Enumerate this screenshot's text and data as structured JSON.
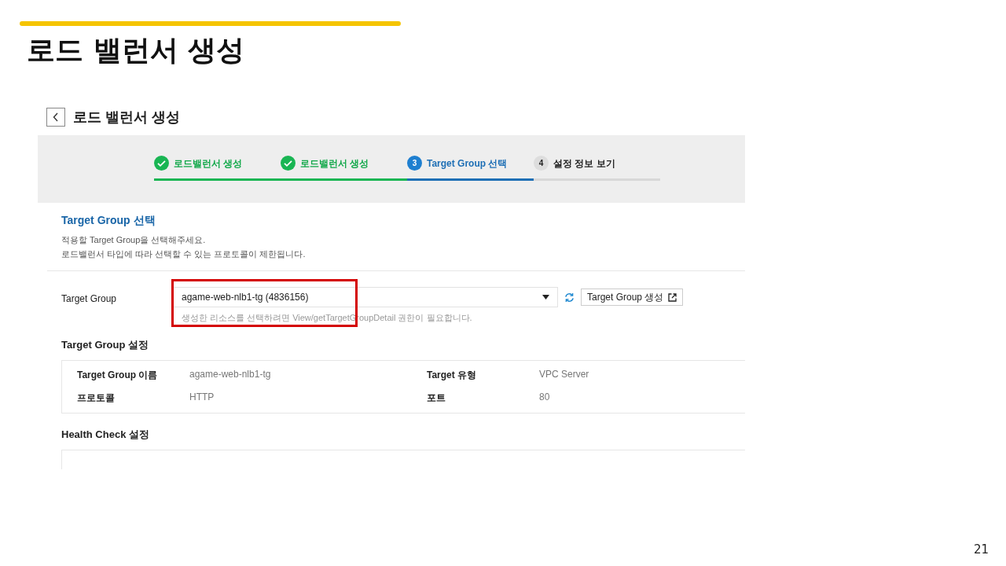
{
  "slide": {
    "title": "로드 밸런서 생성",
    "page_number": "21"
  },
  "screen": {
    "title": "로드 밸런서 생성",
    "steps": [
      {
        "label": "로드밸런서 생성",
        "done": true,
        "current": false
      },
      {
        "label": "로드밸런서 생성",
        "done": true,
        "current": false
      },
      {
        "label": "Target Group 선택",
        "number": "3",
        "done": false,
        "current": true
      },
      {
        "label": "설정 정보 보기",
        "number": "4",
        "done": false,
        "current": false
      }
    ],
    "section": {
      "title": "Target Group 선택",
      "description": [
        "적용할 Target Group을 선택해주세요.",
        "로드밸런서 타입에 따라 선택할 수 있는 프로토콜이 제한됩니다."
      ]
    },
    "target_group": {
      "label": "Target Group",
      "value": "agame-web-nlb1-tg (4836156)",
      "create_button": "Target Group 생성",
      "help": "생성한 리소스를 선택하려면 View/getTargetGroupDetail 권한이 필요합니다.",
      "highlighted": true
    },
    "settings": [
      {
        "title": "Target Group 설정",
        "rows": [
          {
            "label1": "Target Group 이름",
            "value1": "agame-web-nlb1-tg",
            "label2": "Target 유형",
            "value2": "VPC Server"
          },
          {
            "label1": "프로토콜",
            "value1": "HTTP",
            "label2": "포트",
            "value2": "80"
          }
        ]
      },
      {
        "title": "Health Check 설정"
      }
    ]
  }
}
